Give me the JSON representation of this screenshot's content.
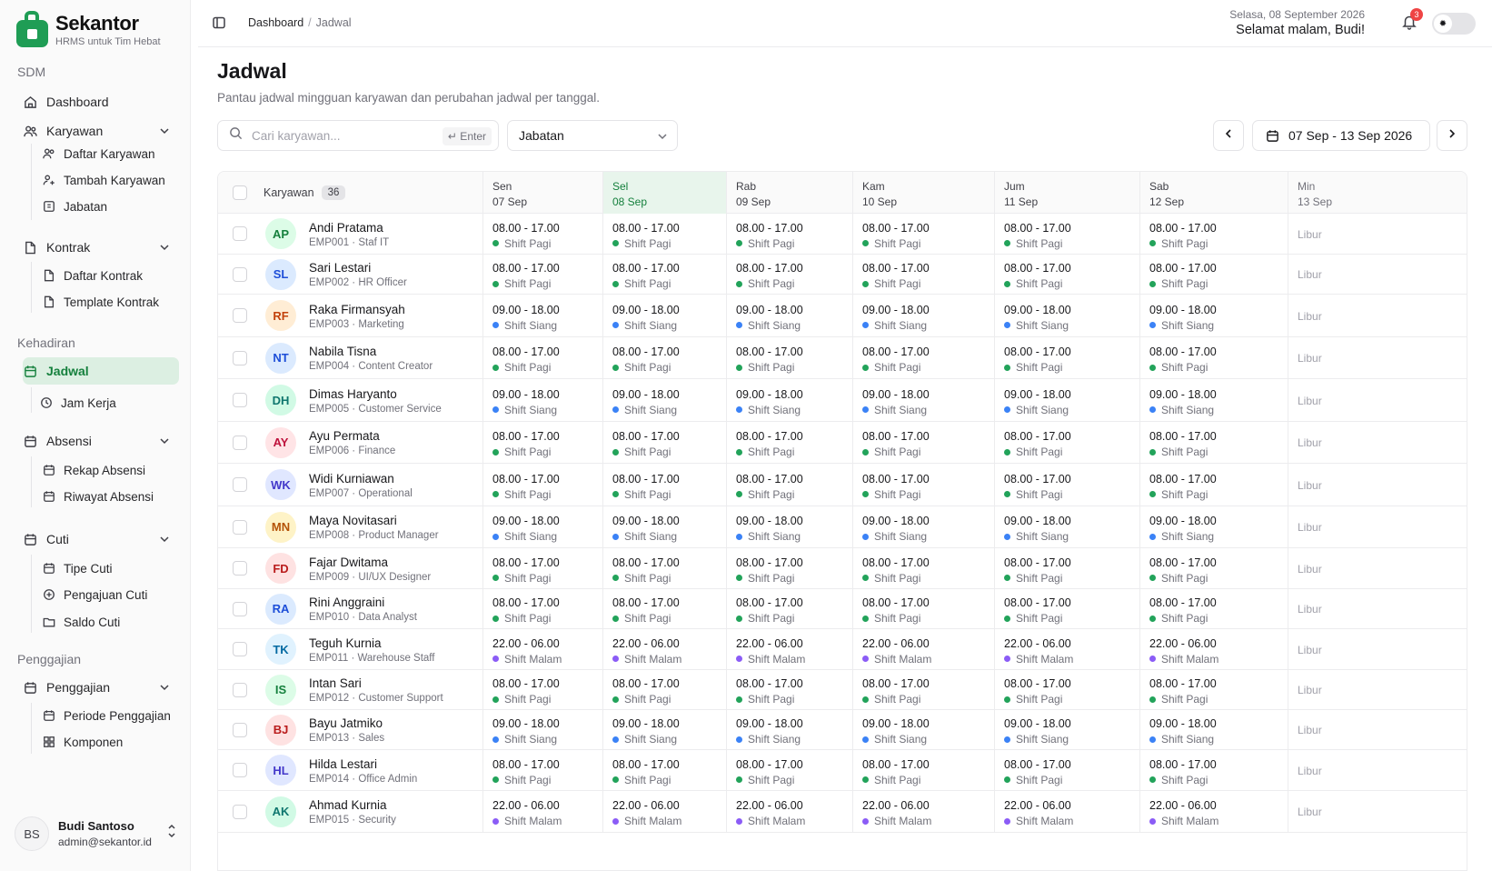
{
  "app": {
    "name": "Sekantor",
    "tagline": "HRMS untuk Tim Hebat"
  },
  "sidebar": {
    "sections": [
      {
        "label": "SDM"
      },
      {
        "label": "Kehadiran"
      },
      {
        "label": "Penggajian"
      }
    ],
    "items": [
      {
        "label": "Dashboard",
        "icon": "home-icon"
      },
      {
        "label": "Karyawan",
        "icon": "users-icon"
      },
      {
        "label": "Daftar Karyawan",
        "icon": "users-icon"
      },
      {
        "label": "Tambah Karyawan",
        "icon": "user-plus-icon"
      },
      {
        "label": "Jabatan",
        "icon": "briefcase-icon"
      },
      {
        "label": "Kontrak",
        "icon": "file-icon"
      },
      {
        "label": "Daftar Kontrak",
        "icon": "file-icon"
      },
      {
        "label": "Template Kontrak",
        "icon": "file-icon"
      },
      {
        "label": "Jadwal",
        "icon": "calendar-icon"
      },
      {
        "label": "Jam Kerja",
        "icon": "clock-icon"
      },
      {
        "label": "Absensi",
        "icon": "calendar-icon"
      },
      {
        "label": "Rekap Absensi",
        "icon": "calendar-icon"
      },
      {
        "label": "Riwayat Absensi",
        "icon": "calendar-icon"
      },
      {
        "label": "Cuti",
        "icon": "calendar-icon"
      },
      {
        "label": "Tipe Cuti",
        "icon": "calendar-icon"
      },
      {
        "label": "Pengajuan Cuti",
        "icon": "plus-circle-icon"
      },
      {
        "label": "Saldo Cuti",
        "icon": "folder-icon"
      },
      {
        "label": "Penggajian",
        "icon": "calendar-icon"
      },
      {
        "label": "Periode Penggajian",
        "icon": "calendar-icon"
      },
      {
        "label": "Komponen",
        "icon": "grid-icon"
      }
    ],
    "user": {
      "initials": "BS",
      "name": "Budi Santoso",
      "email": "admin@sekantor.id"
    }
  },
  "header": {
    "breadcrumb": [
      "Dashboard",
      "Jadwal"
    ],
    "date": "Selasa, 08 September 2026",
    "greeting": "Selamat malam, Budi!",
    "notifications": "3"
  },
  "page": {
    "title": "Jadwal",
    "subtitle": "Pantau jadwal mingguan karyawan dan perubahan jadwal per tanggal."
  },
  "filters": {
    "search_placeholder": "Cari karyawan...",
    "search_hint": "↵ Enter",
    "position_select": "Jabatan",
    "date_range": "07 Sep - 13 Sep 2026"
  },
  "table": {
    "employee_header": "Karyawan",
    "employee_count": "36",
    "days": [
      {
        "day": "Sen",
        "date": "07 Sep"
      },
      {
        "day": "Sel",
        "date": "08 Sep"
      },
      {
        "day": "Rab",
        "date": "09 Sep"
      },
      {
        "day": "Kam",
        "date": "10 Sep"
      },
      {
        "day": "Jum",
        "date": "11 Sep"
      },
      {
        "day": "Sab",
        "date": "12 Sep"
      },
      {
        "day": "Min",
        "date": "13 Sep"
      }
    ],
    "off_label": "Libur",
    "shift_colors": {
      "Shift Pagi": "#22a35a",
      "Shift Siang": "#3b82f6",
      "Shift Malam": "#8b5cf6"
    },
    "rows": [
      {
        "initials": "AP",
        "name": "Andi Pratama",
        "sub": "EMP001 · Staf IT",
        "time": "08.00 - 17.00",
        "shift": "Shift Pagi",
        "color": "#15803d",
        "bg": "#dcfce7"
      },
      {
        "initials": "SL",
        "name": "Sari Lestari",
        "sub": "EMP002 · HR Officer",
        "time": "08.00 - 17.00",
        "shift": "Shift Pagi",
        "color": "#1d4ed8",
        "bg": "#dbeafe"
      },
      {
        "initials": "RF",
        "name": "Raka Firmansyah",
        "sub": "EMP003 · Marketing",
        "time": "09.00 - 18.00",
        "shift": "Shift Siang",
        "color": "#c2410c",
        "bg": "#ffedd5"
      },
      {
        "initials": "NT",
        "name": "Nabila Tisna",
        "sub": "EMP004 · Content Creator",
        "time": "08.00 - 17.00",
        "shift": "Shift Pagi",
        "color": "#1d4ed8",
        "bg": "#dbeafe"
      },
      {
        "initials": "DH",
        "name": "Dimas Haryanto",
        "sub": "EMP005 · Customer Service",
        "time": "09.00 - 18.00",
        "shift": "Shift Siang",
        "color": "#0f766e",
        "bg": "#d1fae5"
      },
      {
        "initials": "AY",
        "name": "Ayu Permata",
        "sub": "EMP006 · Finance",
        "time": "08.00 - 17.00",
        "shift": "Shift Pagi",
        "color": "#be123c",
        "bg": "#ffe4e6"
      },
      {
        "initials": "WK",
        "name": "Widi Kurniawan",
        "sub": "EMP007 · Operational",
        "time": "08.00 - 17.00",
        "shift": "Shift Pagi",
        "color": "#4338ca",
        "bg": "#e0e7ff"
      },
      {
        "initials": "MN",
        "name": "Maya Novitasari",
        "sub": "EMP008 · Product Manager",
        "time": "09.00 - 18.00",
        "shift": "Shift Siang",
        "color": "#b45309",
        "bg": "#fef3c7"
      },
      {
        "initials": "FD",
        "name": "Fajar Dwitama",
        "sub": "EMP009 · UI/UX Designer",
        "time": "08.00 - 17.00",
        "shift": "Shift Pagi",
        "color": "#b91c1c",
        "bg": "#fee2e2"
      },
      {
        "initials": "RA",
        "name": "Rini Anggraini",
        "sub": "EMP010 · Data Analyst",
        "time": "08.00 - 17.00",
        "shift": "Shift Pagi",
        "color": "#1d4ed8",
        "bg": "#dbeafe"
      },
      {
        "initials": "TK",
        "name": "Teguh Kurnia",
        "sub": "EMP011 · Warehouse Staff",
        "time": "22.00 - 06.00",
        "shift": "Shift Malam",
        "color": "#0369a1",
        "bg": "#e0f2fe"
      },
      {
        "initials": "IS",
        "name": "Intan Sari",
        "sub": "EMP012 · Customer Support",
        "time": "08.00 - 17.00",
        "shift": "Shift Pagi",
        "color": "#15803d",
        "bg": "#dcfce7"
      },
      {
        "initials": "BJ",
        "name": "Bayu Jatmiko",
        "sub": "EMP013 · Sales",
        "time": "09.00 - 18.00",
        "shift": "Shift Siang",
        "color": "#b91c1c",
        "bg": "#fee2e2"
      },
      {
        "initials": "HL",
        "name": "Hilda Lestari",
        "sub": "EMP014 · Office Admin",
        "time": "08.00 - 17.00",
        "shift": "Shift Pagi",
        "color": "#4338ca",
        "bg": "#e0e7ff"
      },
      {
        "initials": "AK",
        "name": "Ahmad Kurnia",
        "sub": "EMP015 · Security",
        "time": "22.00 - 06.00",
        "shift": "Shift Malam",
        "color": "#0f766e",
        "bg": "#d1fae5"
      }
    ]
  }
}
